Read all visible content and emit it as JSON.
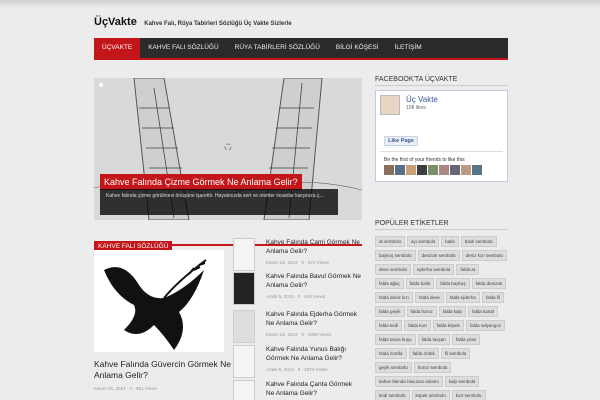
{
  "header": {
    "title": "ÜçVakte",
    "description": "Kahve Falı, Rüya Tabirleri Sözlüğü Üç Vakte Sizlerle"
  },
  "nav": [
    {
      "label": "ÜÇVAKTE"
    },
    {
      "label": "KAHVE FALI SÖZLÜĞÜ"
    },
    {
      "label": "RÜYA TABİRLERİ SÖZLÜĞÜ"
    },
    {
      "label": "BİLGİ KÖŞESİ"
    },
    {
      "label": "İLETİŞİM"
    }
  ],
  "slider": {
    "title": "Kahve Falında Çizme Görmek Ne Anlama Gelir?",
    "excerpt": "Kahve falında çizme görülmesi önüşüne işarettir. Hayatınızda sert ve otoriter insanlar karşınıza ç..."
  },
  "section": {
    "label": "KAHVE FALI SÖZLÜĞÜ"
  },
  "featured": {
    "title": "Kahve Falında Güvercin Görmek Ne Anlama Gelir?",
    "meta": "Kasım 25, 2013  ·  0  ·  651 Views"
  },
  "posts": [
    {
      "title": "Kahve Falında Cami Görmek Ne Anlama Gelir?",
      "meta": "Kasım 25, 2013  ·  0  ·  574 Views"
    },
    {
      "title": "Kahve Falında Bavul Görmek Ne Anlama Gelir?",
      "meta": "Aralık 5, 2013  ·  0  ·  449 Views"
    },
    {
      "title": "Kahve Falında Ejderha Görmek Ne Anlama Gelir?",
      "meta": "Kasım 25, 2013  ·  0  ·  4990 Views"
    },
    {
      "title": "Kahve Falında Yunus Balığı Görmek Ne Anlama Gelir?",
      "meta": "Aralık 5, 2013  ·  0  ·  2074 Views"
    },
    {
      "title": "Kahve Falında Çanta Görmek Ne Anlama Gelir?",
      "meta": ""
    }
  ],
  "facebook": {
    "heading": "FACEBOOK'TA ÜÇVAKTE",
    "page_name": "Üç Vakte",
    "likes": "108 likes",
    "like_button": "Like Page",
    "friends_text": "Be the first of your friends to like this"
  },
  "tags_widget": {
    "heading": "POPÜLER ETİKETLER",
    "tags": [
      "at sembolü",
      "ayı sembolü",
      "balık",
      "balık sembolü",
      "baykuş sembolü",
      "denizatı sembolü",
      "deniz kızı sembolü",
      "deve sembolü",
      "ejderha sembolü",
      "falda at",
      "falda ağaç",
      "falda balık",
      "falda baykuş",
      "falda denizatı",
      "falda deniz kızı",
      "falda deve",
      "falda ejderha",
      "falda fil",
      "falda geyik",
      "falda horoz",
      "falda kalp",
      "falda kartal",
      "falda kedi",
      "falda kurt",
      "falda köpek",
      "falda salyangoz",
      "falda tavus kuşu",
      "falda tavşan",
      "falda yılan",
      "falda zürafa",
      "falda ördek",
      "fil sembolü",
      "geyik sembolü",
      "horoz sembolü",
      "kahve falında havuzun anlamı",
      "kalp sembolü",
      "kedi sembolü",
      "köpek sembolü",
      "kurt sembolü"
    ]
  },
  "colors": {
    "accent": "#c3161a",
    "nav_bg": "#2b2b2b",
    "facebook": "#3b5998"
  },
  "icons": {
    "loading": "loading-spinner-icon",
    "clock": "clock-icon",
    "comment": "comment-icon",
    "views": "eye-icon"
  }
}
